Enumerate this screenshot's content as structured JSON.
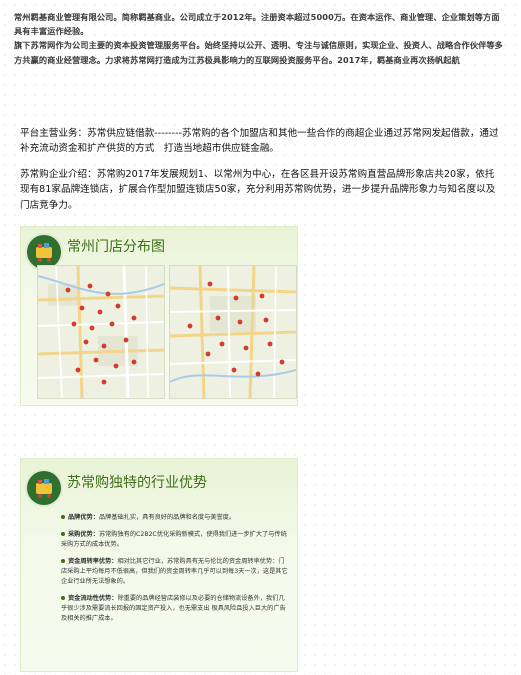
{
  "intro": {
    "line1": "常州羁基商业管理有限公司。简称羁基商业。公司成立于2012年。注册资本超过5000万。在资本运作、商业管理、企业策划等方面具有丰富运作经验。",
    "line2": "旗下苏常网作为公司主要的资本投资管理服务平台。始终坚持以公开、透明、专注与诚信原则，实现企业、投资人、战略合作伙伴等多方共赢的商业经营理念。力求将苏常网打造成为江苏极具影响力的互联网投资服务平台。2017年，羁基商业再次扬帆起航"
  },
  "business": {
    "text": "平台主营业务：苏常供应链借款--------苏常购的各个加盟店和其他一些合作的商超企业通过苏常网发起借款，通过补充流动资金和扩产供货的方式　打造当地超市供应链金融。"
  },
  "company": {
    "text": "苏常购企业介绍：苏常购2017年发展规划1、以常州为中心，在各区县开设苏常购直营品牌形象店共20家，依托现有81家品牌连锁店，扩展合作型加盟连锁店50家，充分利用苏常购优势，进一步提升品牌形象力与知名度以及门店竞争力。"
  },
  "map_section": {
    "title": "常州门店分布图"
  },
  "advantage_section": {
    "title": "苏常购独特的行业优势",
    "items": [
      {
        "label": "品牌优势：",
        "text": "品牌基础扎实，具有良好的品牌和名度与美誉度。"
      },
      {
        "label": "采购优势：",
        "text": "苏常购独有的C2B2C优化采购新模式，使得我们进一步扩大了与传统采购方式的成本优势。"
      },
      {
        "label": "资金周转率优势：",
        "text": "相对比其它行业，苏常购具有无与伦比的资金周转率优势：门店采购上平均每月不低很高，但我们的资金周转率几乎可以到每3天一次，这是其它企业行业所无法想象的。"
      },
      {
        "label": "资金流动性优势：",
        "text": "除重要的品牌经营店装修以及必要的仓储物流设备外，我们几乎很少涉及需要流长回报的固定资产投入，也无需支出 极具风险且投入巨大的广告及相关的推广成本。"
      }
    ]
  },
  "colors": {
    "accent": "#3b6f18",
    "panel_bg": "#eef6df",
    "marker": "#d63a2a"
  }
}
